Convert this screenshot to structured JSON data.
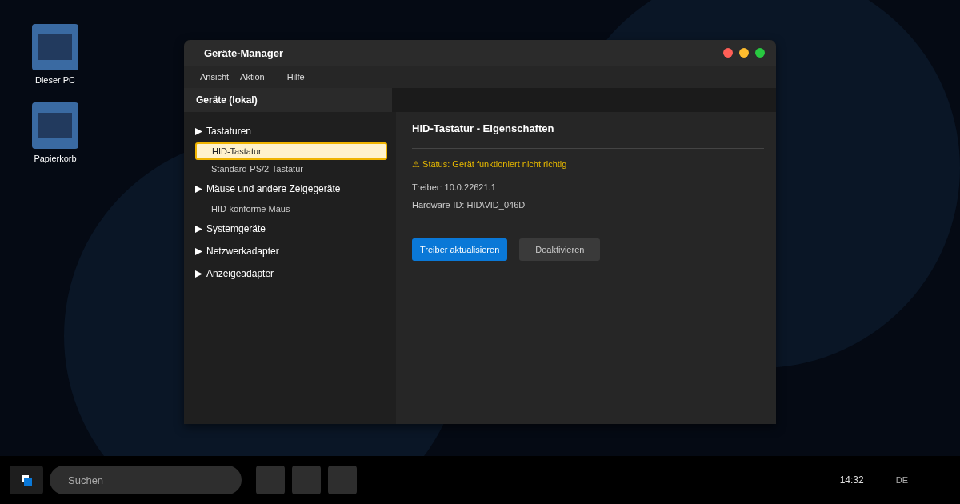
{
  "desktop_icons": [
    {
      "label": "Dieser PC"
    },
    {
      "label": "Papierkorb"
    }
  ],
  "window": {
    "title": "Geräte-Manager",
    "controls": [
      {
        "color": "#ff5f57"
      },
      {
        "color": "#febc2e"
      },
      {
        "color": "#28c840"
      }
    ]
  },
  "menu": [
    "Ansicht",
    "Aktion",
    "Hilfe"
  ],
  "tree": {
    "header": "Geräte (lokal)",
    "categories": [
      {
        "label": "Tastaturen",
        "children": [
          {
            "label": "HID-Tastatur",
            "selected": true
          },
          {
            "label": "Standard-PS/2-Tastatur",
            "selected": false
          }
        ]
      },
      {
        "label": "Mäuse und andere Zeigegeräte",
        "children": [
          {
            "label": "HID-konforme Maus",
            "selected": false
          }
        ]
      },
      {
        "label": "Systemgeräte"
      },
      {
        "label": "Netzwerkadapter"
      },
      {
        "label": "Anzeigeadapter"
      }
    ]
  },
  "details": {
    "title": "HID-Tastatur - Eigenschaften",
    "status": "⚠ Status: Gerät funktioniert nicht richtig",
    "lines": [
      "Treiber: 10.0.22621.1",
      "Hardware-ID: HID\\VID_046D"
    ],
    "buttons": [
      {
        "label": "Treiber aktualisieren",
        "kind": "primary"
      },
      {
        "label": "Deaktivieren",
        "kind": "secondary"
      }
    ]
  },
  "taskbar": {
    "search": {
      "placeholder": "Suchen"
    },
    "apps": [
      {
        "kind": "app"
      },
      {
        "kind": "app"
      },
      {
        "kind": "app"
      }
    ],
    "clock": "14:32",
    "language": "DE"
  }
}
